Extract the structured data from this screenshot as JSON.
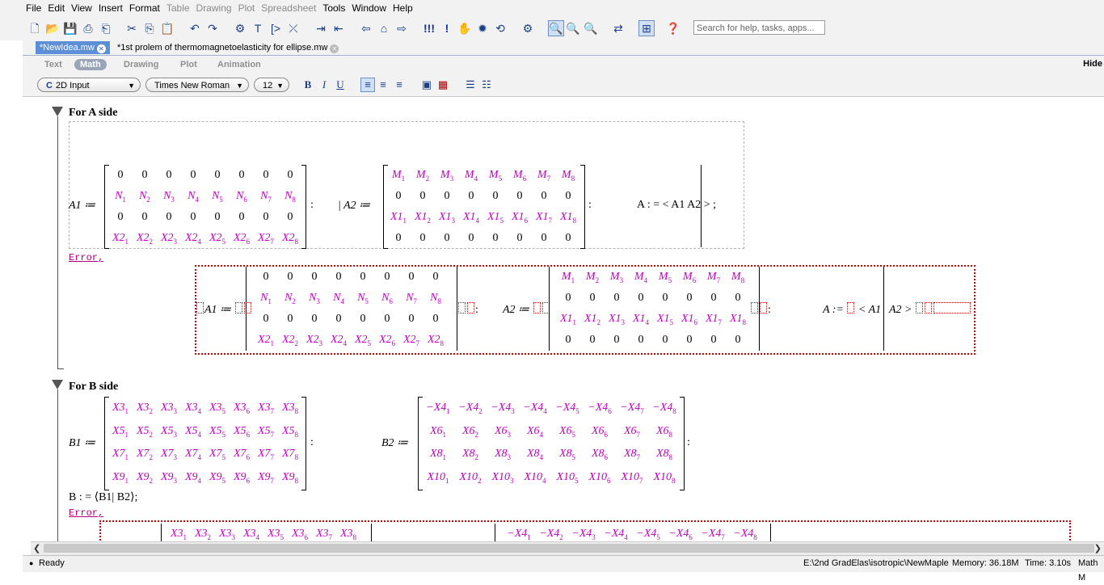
{
  "menu": [
    "File",
    "Edit",
    "View",
    "Insert",
    "Format",
    "Table",
    "Drawing",
    "Plot",
    "Spreadsheet",
    "Tools",
    "Window",
    "Help"
  ],
  "menu_dim": [
    false,
    false,
    false,
    false,
    false,
    true,
    true,
    true,
    true,
    false,
    false,
    false
  ],
  "toolbar": {
    "search_placeholder": "Search for help, tasks, apps..."
  },
  "tabs": [
    {
      "label": "*NewIdea.mw",
      "active": true
    },
    {
      "label": "*1st prolem of thermomagnetoelasticity for ellipse.mw",
      "active": false
    }
  ],
  "modes": [
    {
      "label": "Text",
      "on": false
    },
    {
      "label": "Math",
      "on": true
    },
    {
      "label": "Drawing",
      "on": false
    },
    {
      "label": "Plot",
      "on": false
    },
    {
      "label": "Animation",
      "on": false
    }
  ],
  "hide_label": "Hide",
  "format": {
    "input_mode": "2D Input",
    "font": "Times New Roman",
    "size": "12"
  },
  "sectionA": {
    "title": "For A side",
    "a1_label": "A1 ≔",
    "a2_label": "| A2 ≔",
    "a_expr": "A : = < A1  A2 > ;",
    "error": "Error,",
    "err_a1": "A1 ≔",
    "err_a2": "A2 ≔",
    "err_a": "A := ",
    "err_a_rest": "< A1",
    "err_a_tail": "A2 >"
  },
  "sectionB": {
    "title": "For B side",
    "b1_label": "B1 ≔",
    "b2_label": "B2 ≔",
    "b_expr": "B : = ⟨B1| B2⟩;",
    "error": "Error,"
  },
  "status": {
    "ready": "Ready",
    "path": "E:\\2nd GradElas\\isotropic\\NewMaple",
    "memory": "Memory: 36.18M",
    "time": "Time: 3.10s",
    "mode": "Math M"
  }
}
